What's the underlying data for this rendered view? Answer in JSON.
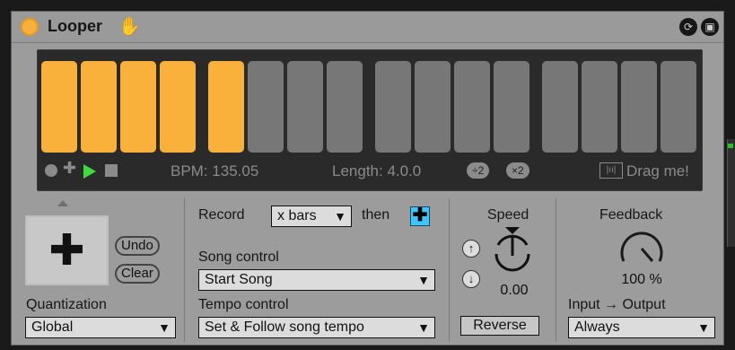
{
  "title": "Looper",
  "display": {
    "cells": [
      true,
      true,
      true,
      true,
      true,
      false,
      false,
      false,
      false,
      false,
      false,
      false,
      false,
      false,
      false,
      false
    ],
    "bpm": "BPM: 135.05",
    "length": "Length: 4.0.0",
    "div_button": "÷2",
    "mul_button": "×2",
    "drag_label": "Drag me!"
  },
  "left": {
    "undo": "Undo",
    "clear": "Clear",
    "quantization_label": "Quantization",
    "quantization_value": "Global"
  },
  "record": {
    "record_label": "Record",
    "record_value": "x bars",
    "then_label": "then",
    "song_control_label": "Song control",
    "song_control_value": "Start Song",
    "tempo_control_label": "Tempo control",
    "tempo_control_value": "Set & Follow song tempo"
  },
  "speed": {
    "label": "Speed",
    "value": "0.00",
    "reverse": "Reverse"
  },
  "feedback": {
    "label": "Feedback",
    "value": "100 %",
    "io_label": "Input → Output",
    "io_value": "Always"
  }
}
